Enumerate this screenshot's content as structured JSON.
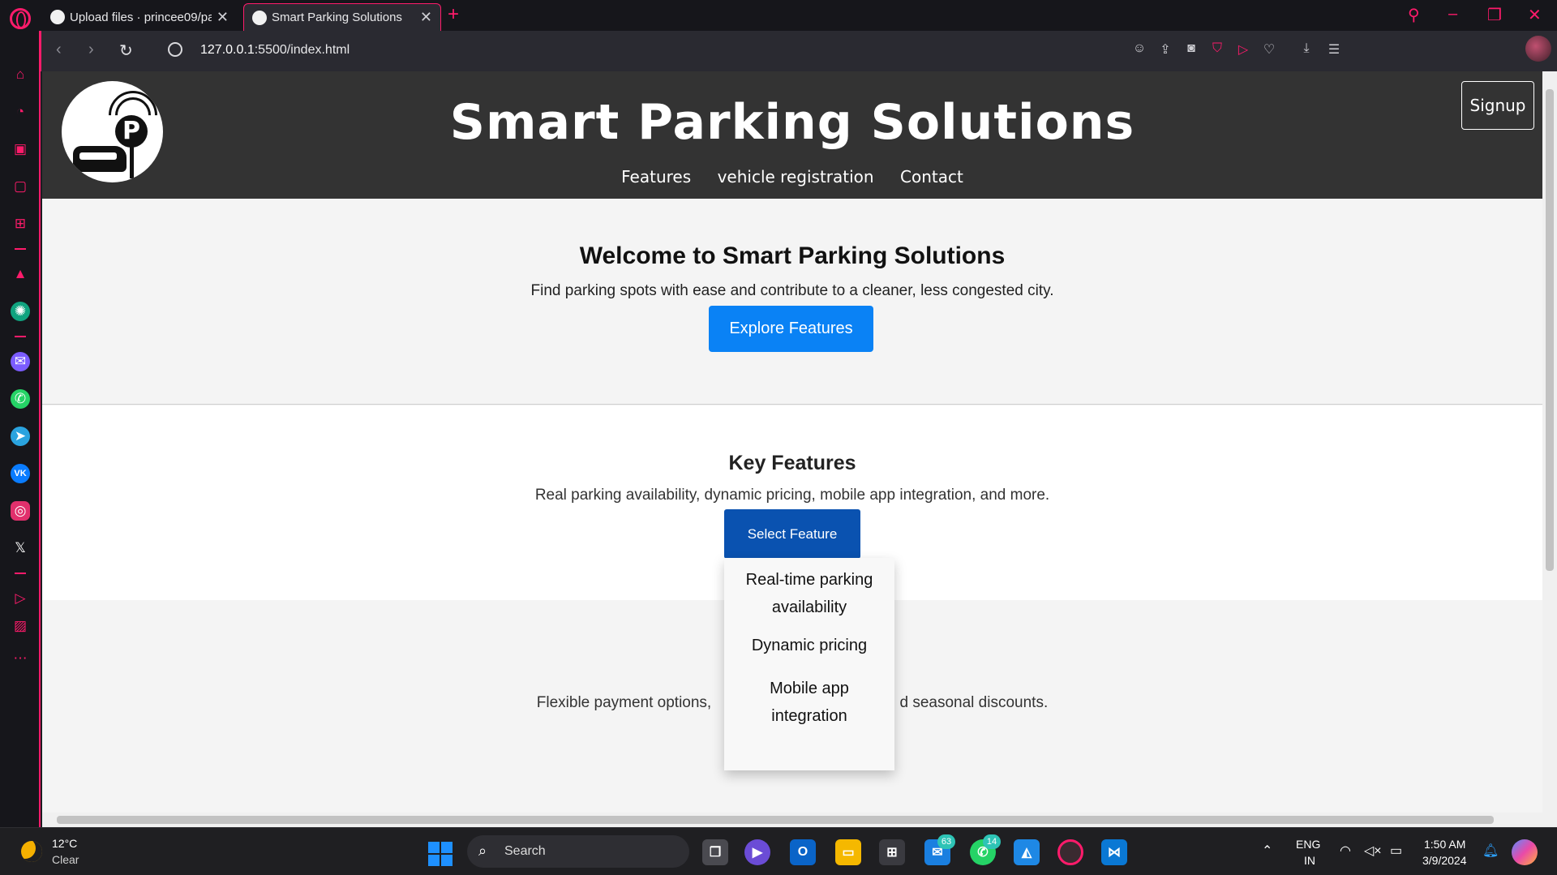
{
  "browser": {
    "tabs": [
      {
        "title": "Upload files · princee09/pa",
        "active": false
      },
      {
        "title": "Smart Parking Solutions",
        "active": true
      }
    ],
    "url": {
      "host": "127.0.0.1",
      "path": ":5500/index.html"
    },
    "accent": "#ff1b6b"
  },
  "site": {
    "title": "Smart Parking Solutions",
    "nav": [
      "Features",
      "vehicle registration",
      "Contact"
    ],
    "signup": "Signup",
    "logo_letter": "P"
  },
  "hero": {
    "heading": "Welcome to Smart Parking Solutions",
    "text": "Find parking spots with ease and contribute to a cleaner, less congested city.",
    "button": "Explore Features",
    "button_color": "#0a82f5"
  },
  "features": {
    "heading": "Key Features",
    "text": "Real parking availability, dynamic pricing, mobile app integration, and more.",
    "button": "Select Feature",
    "button_color": "#0a52b0",
    "dropdown": [
      "Real-time parking availability",
      "Dynamic pricing",
      "Mobile app integration"
    ]
  },
  "pricing": {
    "text_left": "Flexible payment options,",
    "text_right": "d seasonal discounts."
  },
  "taskbar": {
    "weather_temp": "12°C",
    "weather_cond": "Clear",
    "search_label": "Search",
    "badges": {
      "outlook_like": "63",
      "whatsapp": "14"
    },
    "lang": "ENG",
    "region": "IN",
    "time": "1:50 AM",
    "date": "3/9/2024"
  }
}
